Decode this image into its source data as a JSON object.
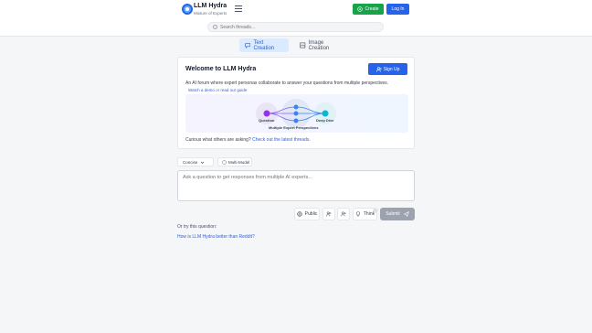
{
  "header": {
    "title": "LLM Hydra",
    "subtitle": "Mixture of Experts",
    "create_label": "Create",
    "login_label": "Log In"
  },
  "search": {
    "placeholder": "Search threads..."
  },
  "tabs": [
    {
      "label": "Text Creation",
      "active": true
    },
    {
      "label": "Image Creation",
      "active": false
    }
  ],
  "welcome": {
    "title": "Welcome to LLM Hydra",
    "signup_label": "Sign Up",
    "description": "An AI forum where expert personas collaborate to answer your questions from multiple perspectives.",
    "link_demo": "Watch a demo",
    "link_separator": "or",
    "link_guide": "read our guide",
    "diagram": {
      "left_label": "Question",
      "right_label": "Deep Dive",
      "caption": "Multiple Expert Perspectives"
    },
    "footer_text": "Curious what others are asking?",
    "footer_link": "Check out the latest threads."
  },
  "composer": {
    "mode": "Concise",
    "multi_model_label": "Multi-Model",
    "placeholder": "Ask a question to get responses from multiple AI experts...",
    "public_label": "Public",
    "think_label": "Think",
    "submit_label": "Submit"
  },
  "suggestion": {
    "label": "Or try this question:",
    "question": "How is LLM Hydra better than Reddit?"
  },
  "colors": {
    "primary": "#2563eb",
    "success": "#16a34a",
    "disabled": "#9ca3af",
    "node_purple": "#9333ea",
    "node_blue": "#3b82f6",
    "node_teal": "#06b6d4"
  }
}
